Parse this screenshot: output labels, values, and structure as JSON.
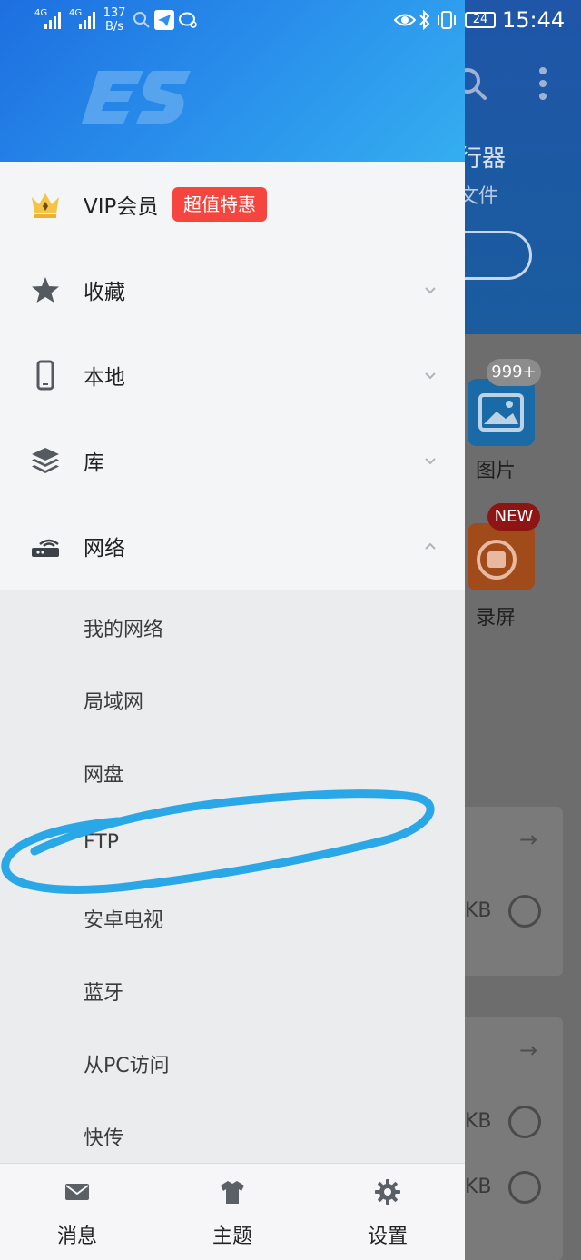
{
  "status_bar": {
    "signal_1": "4G",
    "signal_2": "4G",
    "net_speed_value": "137",
    "net_speed_unit": "B/s",
    "battery": "24",
    "time": "15:44"
  },
  "drawer": {
    "vip": {
      "label": "VIP会员",
      "badge": "超值特惠",
      "icon": "crown-icon"
    },
    "items": [
      {
        "label": "收藏",
        "icon": "star-icon",
        "expanded": false
      },
      {
        "label": "本地",
        "icon": "phone-icon",
        "expanded": false
      },
      {
        "label": "库",
        "icon": "layers-icon",
        "expanded": false
      },
      {
        "label": "网络",
        "icon": "router-icon",
        "expanded": true
      }
    ],
    "network_children": [
      "我的网络",
      "局域网",
      "网盘",
      "FTP",
      "安卓电视",
      "蓝牙",
      "从PC访问",
      "快传"
    ],
    "bottom_tabs": [
      {
        "label": "消息",
        "icon": "envelope-icon"
      },
      {
        "label": "主题",
        "icon": "tshirt-icon"
      },
      {
        "label": "设置",
        "icon": "gear-icon"
      }
    ]
  },
  "background_app": {
    "header_title_fragment": "行器",
    "header_subtitle_fragment": "文件",
    "tiles": [
      {
        "label": "图片",
        "badge": "999+"
      },
      {
        "label": "录屏",
        "badge": "NEW"
      }
    ],
    "size_fragment": "KB"
  },
  "colors": {
    "drawer_header": "#2a92ec",
    "vip_badge": "#f4453e",
    "annotation_stroke": "#2aa7e6"
  }
}
